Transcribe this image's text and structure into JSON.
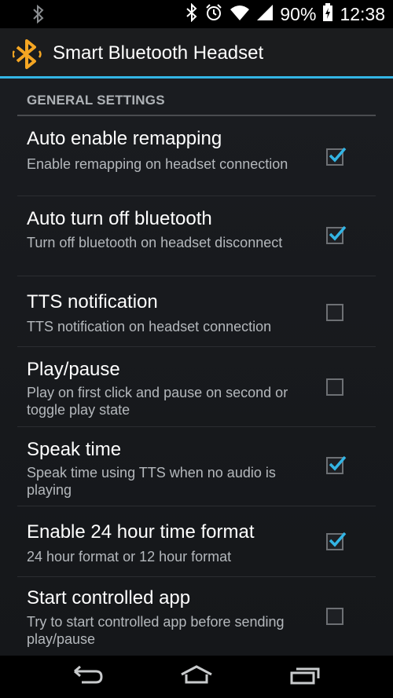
{
  "status_bar": {
    "battery": "90%",
    "time": "12:38",
    "icons": [
      "bluetooth-icon",
      "bluetooth-icon",
      "alarm-icon",
      "wifi-icon",
      "signal-icon",
      "battery-charging-icon"
    ]
  },
  "action_bar": {
    "title": "Smart Bluetooth Headset",
    "icon": "bluetooth-app-icon",
    "accent_color": "#33b5e5"
  },
  "section": {
    "header": "GENERAL SETTINGS"
  },
  "preferences": [
    {
      "title": "Auto enable remapping",
      "summary": "Enable remapping on headset connection",
      "checked": true
    },
    {
      "title": "Auto turn off bluetooth",
      "summary": "Turn off bluetooth on headset disconnect",
      "checked": true
    },
    {
      "title": "TTS notification",
      "summary": "TTS notification on headset connection",
      "checked": false
    },
    {
      "title": "Play/pause",
      "summary": "Play on first click and pause on second or toggle play state",
      "checked": false
    },
    {
      "title": "Speak time",
      "summary": "Speak time using TTS when no audio is playing",
      "checked": true
    },
    {
      "title": "Enable 24 hour time format",
      "summary": "24 hour format or 12 hour format",
      "checked": true
    },
    {
      "title": "Start controlled app",
      "summary": "Try to start controlled app before sending play/pause",
      "checked": false
    }
  ],
  "nav_bar": {
    "icons": [
      "back-icon",
      "home-icon",
      "recent-apps-icon"
    ]
  }
}
